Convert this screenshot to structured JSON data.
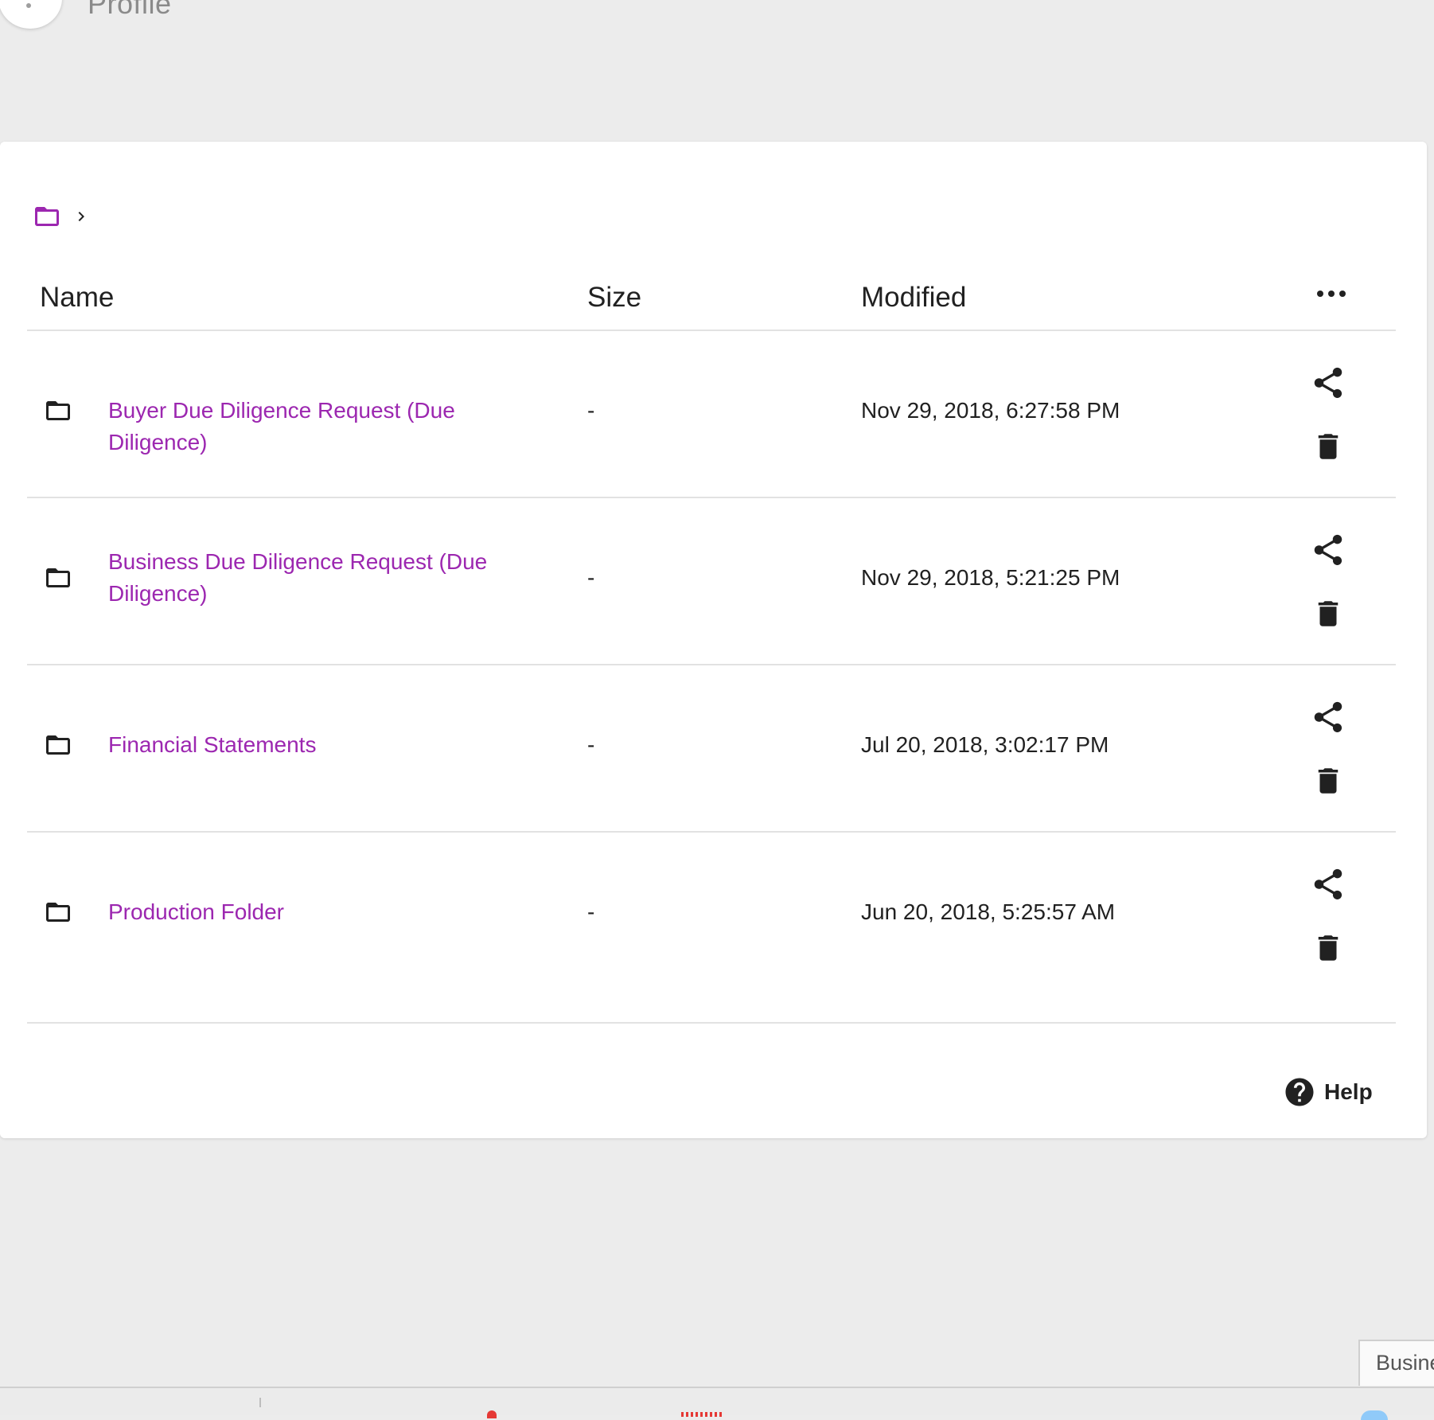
{
  "topbar": {
    "profile_label": "Profile"
  },
  "breadcrumb": {
    "root_icon": "folder-outline-icon",
    "separator_icon": "chevron-right-icon"
  },
  "table": {
    "columns": {
      "name": "Name",
      "size": "Size",
      "modified": "Modified"
    },
    "more_icon": "more-horiz-icon",
    "rows": [
      {
        "name": "Buyer Due Diligence Request (Due Diligence)",
        "size": "-",
        "modified": "Nov 29, 2018, 6:27:58 PM"
      },
      {
        "name": "Business Due Diligence Request (Due Diligence)",
        "size": "-",
        "modified": "Nov 29, 2018, 5:21:25 PM"
      },
      {
        "name": "Financial Statements",
        "size": "-",
        "modified": "Jul 20, 2018, 3:02:17 PM"
      },
      {
        "name": "Production Folder",
        "size": "-",
        "modified": "Jun 20, 2018, 5:25:57 AM"
      }
    ],
    "row_icons": {
      "type": "folder-icon",
      "share": "share-icon",
      "delete": "delete-icon"
    }
  },
  "help": {
    "label": "Help",
    "icon": "help-circle-icon"
  },
  "bottom_tab": {
    "label": "Busine"
  },
  "colors": {
    "accent": "#9c27b0",
    "text": "#212121",
    "background": "#ececec",
    "card": "#ffffff",
    "divider": "#e2e2e2"
  }
}
